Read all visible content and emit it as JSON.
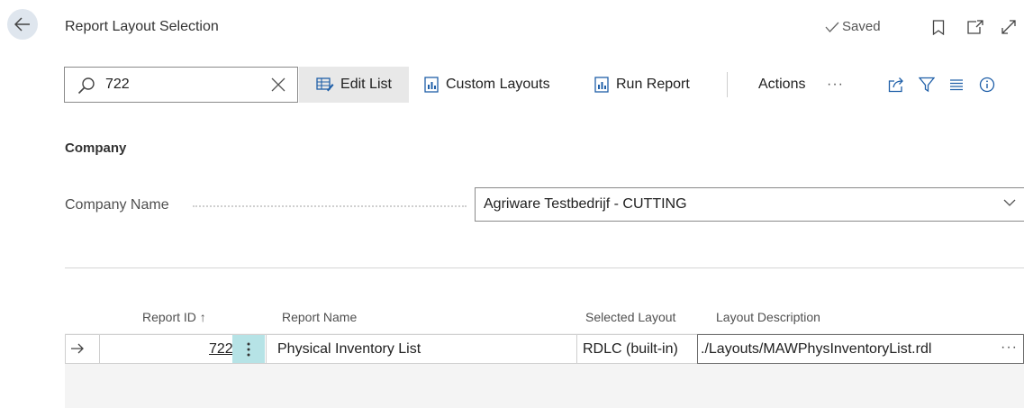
{
  "header": {
    "title": "Report Layout Selection",
    "saved_label": "Saved",
    "icons": [
      "bookmark-icon",
      "open-new-window-icon",
      "expand-icon"
    ]
  },
  "toolbar": {
    "search_value": "722",
    "edit_list_label": "Edit List",
    "custom_layouts_label": "Custom Layouts",
    "run_report_label": "Run Report",
    "actions_label": "Actions",
    "more_label": "···",
    "icons": [
      "share-icon",
      "filter-icon",
      "list-view-icon",
      "info-icon"
    ]
  },
  "company": {
    "section_title": "Company",
    "field_label": "Company Name",
    "value": "Agriware Testbedrijf - CUTTING"
  },
  "grid": {
    "columns": [
      "Report ID ↑",
      "Report Name",
      "Selected Layout",
      "Layout Description"
    ],
    "rows": [
      {
        "report_id": "722",
        "report_name": "Physical Inventory List",
        "selected_layout": "RDLC (built-in)",
        "layout_description": "./Layouts/MAWPhysInventoryList.rdl"
      }
    ]
  },
  "colors": {
    "selected_cell": "#b6e3e6",
    "active_toolbar_button": "#e8e8e8",
    "back_button": "#dfe6ee",
    "grid_background": "#f4f4f4"
  }
}
